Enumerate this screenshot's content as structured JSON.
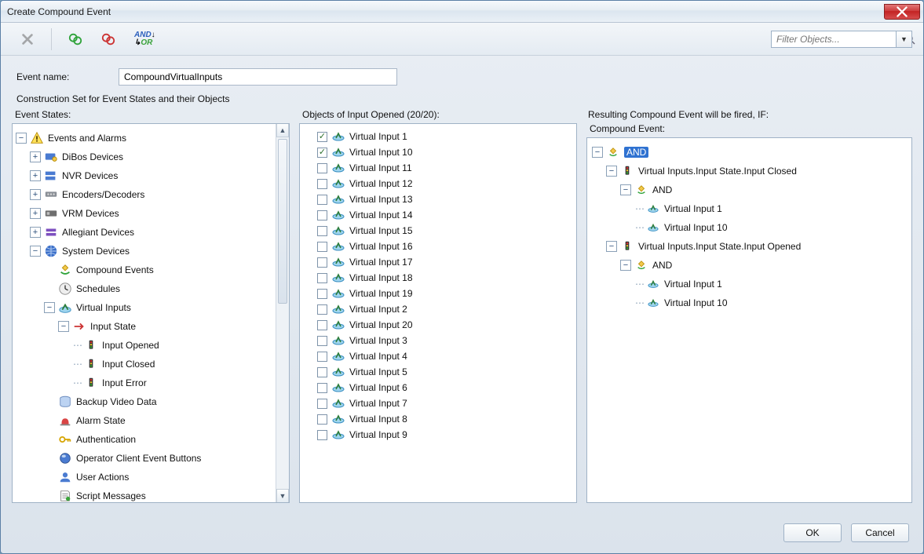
{
  "window": {
    "title": "Create Compound Event"
  },
  "toolbar": {
    "and_label": "AND",
    "or_label": "OR",
    "filter_placeholder": "Filter Objects..."
  },
  "event_name": {
    "label": "Event name:",
    "value": "CompoundVirtualInputs"
  },
  "labels": {
    "construction": "Construction Set for Event States and their Objects",
    "event_states": "Event States:",
    "objects_of": "Objects of Input Opened (20/20):",
    "resulting": "Resulting Compound Event will be fired, IF:",
    "compound_event": "Compound Event:"
  },
  "event_states_tree": {
    "root": "Events and Alarms",
    "items": [
      "DiBos Devices",
      "NVR Devices",
      "Encoders/Decoders",
      "VRM Devices",
      "Allegiant Devices"
    ],
    "system": {
      "label": "System Devices",
      "children": [
        "Compound Events",
        "Schedules"
      ],
      "virtual_inputs": {
        "label": "Virtual Inputs",
        "input_state": {
          "label": "Input State",
          "children": [
            "Input Opened",
            "Input Closed",
            "Input Error"
          ]
        }
      },
      "rest": [
        "Backup Video Data",
        "Alarm State",
        "Authentication",
        "Operator Client Event Buttons",
        "User Actions",
        "Script Messages"
      ]
    }
  },
  "objects_list": [
    {
      "label": "Virtual Input 1",
      "checked": true
    },
    {
      "label": "Virtual Input 10",
      "checked": true
    },
    {
      "label": "Virtual Input 11",
      "checked": false
    },
    {
      "label": "Virtual Input 12",
      "checked": false
    },
    {
      "label": "Virtual Input 13",
      "checked": false
    },
    {
      "label": "Virtual Input 14",
      "checked": false
    },
    {
      "label": "Virtual Input 15",
      "checked": false
    },
    {
      "label": "Virtual Input 16",
      "checked": false
    },
    {
      "label": "Virtual Input 17",
      "checked": false
    },
    {
      "label": "Virtual Input 18",
      "checked": false
    },
    {
      "label": "Virtual Input 19",
      "checked": false
    },
    {
      "label": "Virtual Input 2",
      "checked": false
    },
    {
      "label": "Virtual Input 20",
      "checked": false
    },
    {
      "label": "Virtual Input 3",
      "checked": false
    },
    {
      "label": "Virtual Input 4",
      "checked": false
    },
    {
      "label": "Virtual Input 5",
      "checked": false
    },
    {
      "label": "Virtual Input 6",
      "checked": false
    },
    {
      "label": "Virtual Input 7",
      "checked": false
    },
    {
      "label": "Virtual Input 8",
      "checked": false
    },
    {
      "label": "Virtual Input 9",
      "checked": false
    }
  ],
  "compound_tree": {
    "root_and": "AND",
    "closed": {
      "label": "Virtual Inputs.Input State.Input Closed",
      "and": "AND",
      "inputs": [
        "Virtual Input 1",
        "Virtual Input 10"
      ]
    },
    "opened": {
      "label": "Virtual Inputs.Input State.Input Opened",
      "and": "AND",
      "inputs": [
        "Virtual Input 1",
        "Virtual Input 10"
      ]
    }
  },
  "buttons": {
    "ok": "OK",
    "cancel": "Cancel"
  }
}
